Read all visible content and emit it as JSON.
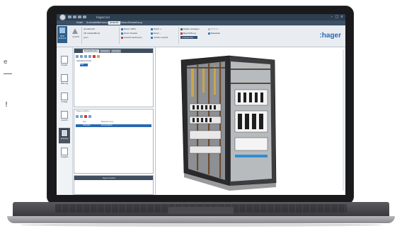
{
  "background_text": {
    "fragment_1": "e",
    "fragment_2": "!"
  },
  "app": {
    "title": "hagercad"
  },
  "menu": {
    "items": [
      "Datei",
      "Aufmaße",
      "Werkzeuge",
      "Ansicht",
      "Einbau",
      "Darstellung"
    ],
    "active_index": 3
  },
  "ribbon": {
    "big_button_label": "HKD Schrank",
    "tool_label": "Ansicht",
    "view_rows": [
      "isometrisch",
      "3D Arbeitsfläche",
      "grün"
    ],
    "zoom_rows_1": [
      "Zoom 100%",
      "Zoom Fenster",
      "Ansicht zentrieren"
    ],
    "zoom_rows_2": [
      "Zoom +",
      "Zoom -",
      "rechte Ansicht"
    ],
    "display_rows_1": [
      "Raster anzeigen",
      "Beschriftung",
      "Ausblenden"
    ],
    "display_rows_2": [
      "Einheit",
      "Massstab"
    ],
    "brand_logo": ":hager"
  },
  "nav": {
    "items": [
      "Projekt",
      "Planung",
      "Anlage",
      "Ansicht",
      "Schrank",
      "Ausgabe"
    ],
    "active_index": 4
  },
  "tree_panel": {
    "tabs": [
      "Projektstruktur",
      "Schrank",
      "Produkt"
    ],
    "rows": [
      "Verteilerschrank",
      "Feld"
    ]
  },
  "props_panel": {
    "title": "Eigenschaften",
    "columns": [
      "Typ",
      "Bezeichnung"
    ],
    "row": [
      "Verteiler",
      "Schrankfeld"
    ]
  },
  "bottom_panel": {
    "title": "Eigenschaften"
  },
  "colors": {
    "accent": "#2a68b2",
    "chrome": "#2d3e4e",
    "brand": "#2a66b8"
  }
}
